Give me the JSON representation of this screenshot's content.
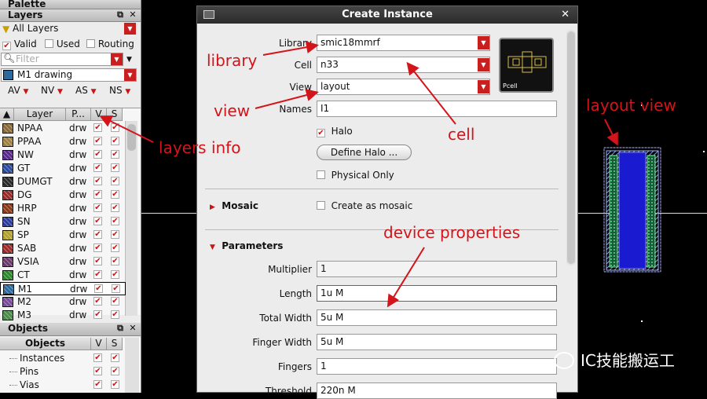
{
  "palette": {
    "title": "Palette",
    "layers": {
      "title": "Layers",
      "filter_select": "All Layers",
      "valid_label": "Valid",
      "used_label": "Used",
      "routing_label": "Routing",
      "filter_placeholder": "Filter",
      "current_layer": "M1 drawing",
      "visibility_buttons": [
        "AV",
        "NV",
        "AS",
        "NS"
      ],
      "columns": {
        "layer": "Layer",
        "purpose": "P...",
        "v": "V",
        "s": "S"
      },
      "rows": [
        {
          "name": "NPAA",
          "purpose": "drw",
          "color": "#8a6a3a"
        },
        {
          "name": "PPAA",
          "purpose": "drw",
          "color": "#a08040"
        },
        {
          "name": "NW",
          "purpose": "drw",
          "color": "#5a2a8a"
        },
        {
          "name": "GT",
          "purpose": "drw",
          "color": "#2a4aa0"
        },
        {
          "name": "DUMGT",
          "purpose": "drw",
          "color": "#2a2a2a"
        },
        {
          "name": "DG",
          "purpose": "drw",
          "color": "#9a2a2a"
        },
        {
          "name": "HRP",
          "purpose": "drw",
          "color": "#8a3a1a"
        },
        {
          "name": "SN",
          "purpose": "drw",
          "color": "#2a3aa0"
        },
        {
          "name": "SP",
          "purpose": "drw",
          "color": "#b0a030"
        },
        {
          "name": "SAB",
          "purpose": "drw",
          "color": "#a02a2a"
        },
        {
          "name": "VSIA",
          "purpose": "drw",
          "color": "#6a3a6a"
        },
        {
          "name": "CT",
          "purpose": "drw",
          "color": "#2a8a2a"
        },
        {
          "name": "M1",
          "purpose": "drw",
          "color": "#2a6aa0"
        },
        {
          "name": "M2",
          "purpose": "drw",
          "color": "#7a4a9a"
        },
        {
          "name": "M3",
          "purpose": "drw",
          "color": "#4a8a4a"
        }
      ]
    },
    "objects": {
      "title": "Objects",
      "header": "Objects",
      "columns": {
        "v": "V",
        "s": "S"
      },
      "rows": [
        "Instances",
        "Pins",
        "Vias"
      ]
    }
  },
  "dialog": {
    "title": "Create Instance",
    "library_label": "Library",
    "library_value": "smic18mmrf",
    "cell_label": "Cell",
    "cell_value": "n33",
    "view_label": "View",
    "view_value": "layout",
    "names_label": "Names",
    "names_value": "I1",
    "halo_label": "Halo",
    "define_halo_label": "Define Halo ...",
    "physical_only_label": "Physical Only",
    "preview_label": "Pcell",
    "mosaic_section": "Mosaic",
    "create_mosaic_label": "Create as mosaic",
    "parameters_section": "Parameters",
    "params": [
      {
        "label": "Multiplier",
        "value": "1",
        "editable": false
      },
      {
        "label": "Length",
        "value": "1u M",
        "editable": true
      },
      {
        "label": "Total Width",
        "value": "5u M",
        "editable": true
      },
      {
        "label": "Finger Width",
        "value": "5u M",
        "editable": true
      },
      {
        "label": "Fingers",
        "value": "1",
        "editable": true
      },
      {
        "label": "Threshold",
        "value": "220n M",
        "editable": true
      }
    ]
  },
  "annotations": {
    "library": "library",
    "view": "view",
    "layers_info": "layers info",
    "cell": "cell",
    "device_properties": "device properties",
    "layout_view": "layout view"
  },
  "watermark": "IC技能搬运工",
  "colors": {
    "accent_red": "#c91f1f",
    "annotation_red": "#d4141b",
    "title_bar": "#333333"
  }
}
